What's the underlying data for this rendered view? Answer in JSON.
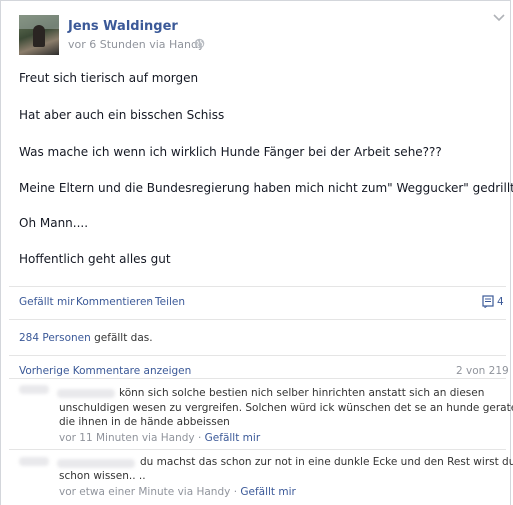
{
  "post": {
    "author": "Jens Waldinger",
    "meta": "vor 6 Stunden via Handy",
    "lines": [
      "Freut sich tierisch auf morgen",
      "Hat aber auch ein bisschen Schiss",
      "Was mache ich wenn ich wirklich Hunde Fänger bei der Arbeit sehe???",
      "Meine Eltern und die Bundesregierung haben mich nicht zum\" Weggucker\" gedrillt...",
      "Oh Mann....",
      "Hoffentlich geht alles gut"
    ]
  },
  "actions": {
    "like": "Gefällt mir",
    "comment": "Kommentieren",
    "share": "Teilen",
    "sep": "·",
    "comment_count": "4"
  },
  "likes": {
    "count_text": "284 Personen",
    "suffix": " gefällt das."
  },
  "comments": {
    "previous_label": "Vorherige Kommentare anzeigen",
    "page_count": "2 von 219",
    "items": [
      {
        "lines": [
          "könn sich solche bestien nich selber hinrichten anstatt sich an diesen",
          "unschuldigen wesen zu vergreifen. Solchen würd ick wünschen det se an hunde geraten",
          "die ihnen in de hände abbeissen"
        ],
        "time": "vor 11 Minuten via Handy",
        "like": "Gefällt mir"
      },
      {
        "lines": [
          "du machst das schon zur not in eine dunkle Ecke und den Rest wirst du",
          "schon wissen.. .."
        ],
        "time": "vor etwa einer Minute via Handy",
        "like": "Gefällt mir"
      }
    ]
  },
  "icons": {
    "chevron": "chevron-down-icon",
    "globe": "globe-icon",
    "comment": "comment-icon"
  },
  "colors": {
    "link": "#3b5998",
    "meta": "#90949c",
    "text": "#141823",
    "border": "#d3d6db"
  }
}
